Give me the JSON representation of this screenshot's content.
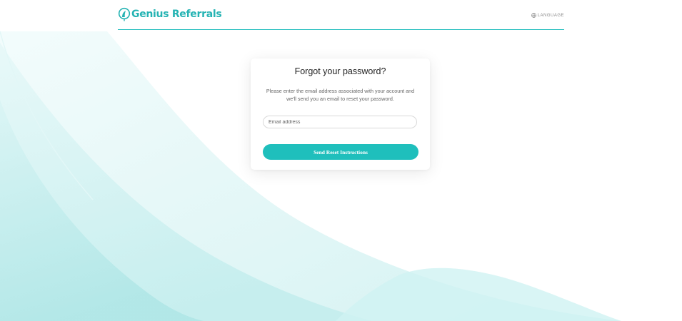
{
  "brand": {
    "name": "Genius Referrals",
    "color": "#25b3b3",
    "icon": "genius-referrals-logo-icon"
  },
  "header": {
    "language_label": "LANGUAGE",
    "language_icon": "globe-icon"
  },
  "card": {
    "title": "Forgot your password?",
    "description": "Please enter the email address associated with your account and we'll send you an email to reset your password.",
    "email_placeholder": "Email address",
    "email_value": "",
    "submit_label": "Send Reset Instructions"
  },
  "colors": {
    "accent": "#1fbfbc",
    "background_tint": "#b8ecec"
  }
}
